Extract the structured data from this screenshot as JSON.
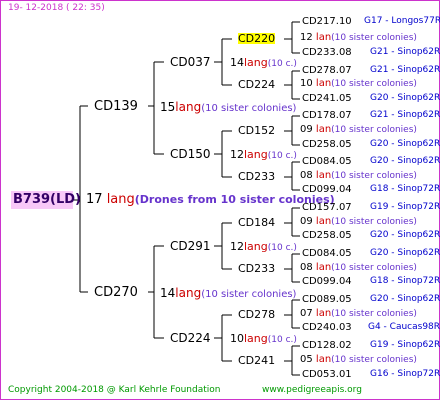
{
  "header": {
    "date": "19-  12-2018  ( 22: 35)"
  },
  "footer": {
    "copyright": "Copyright 2004-2018 @ Karl Kehrle Foundation",
    "website": "www.pedigreeapis.org"
  },
  "root": {
    "id": "B739(LD)",
    "count": "17",
    "word": "lang",
    "note": "(Drones from 10 sister colonies)"
  },
  "gen1": [
    {
      "id": "CD139",
      "count": "15",
      "word": "lang",
      "note": "(10 sister colonies)"
    },
    {
      "id": "CD270",
      "count": "14",
      "word": "lang",
      "note": "(10 sister colonies)"
    }
  ],
  "gen2": [
    {
      "id": "CD037",
      "count": "14",
      "word": "lang",
      "note": "(10 c.)"
    },
    {
      "id": "CD150",
      "count": "12",
      "word": "lang",
      "note": "(10 c.)"
    },
    {
      "id": "CD291",
      "count": "12",
      "word": "lang",
      "note": "(10 c.)"
    },
    {
      "id": "CD224",
      "count": "10",
      "word": "lang",
      "note": "(10 c.)"
    }
  ],
  "gen3": [
    {
      "id": "CD220",
      "count": "12",
      "word": "lan",
      "note": "(10 sister colonies)"
    },
    {
      "id": "CD224",
      "count": "10",
      "word": "lan",
      "note": "(10 sister colonies)"
    },
    {
      "id": "CD152",
      "count": "09",
      "word": "lan",
      "note": "(10 sister colonies)"
    },
    {
      "id": "CD233",
      "count": "08",
      "word": "lan",
      "note": "(10 sister colonies)"
    },
    {
      "id": "CD184",
      "count": "09",
      "word": "lan",
      "note": "(10 sister colonies)"
    },
    {
      "id": "CD233",
      "count": "08",
      "word": "lan",
      "note": "(10 sister colonies)"
    },
    {
      "id": "CD278",
      "count": "07",
      "word": "lan",
      "note": "(10 sister colonies)"
    },
    {
      "id": "CD241",
      "count": "05",
      "word": "lan",
      "note": "(10 sister colonies)"
    }
  ],
  "gen4": [
    {
      "id": "CD217.10",
      "origin": "G17 - Longos77R"
    },
    {
      "id": "CD233.08",
      "origin": "G21 - Sinop62R"
    },
    {
      "id": "CD278.07",
      "origin": "G21 - Sinop62R"
    },
    {
      "id": "CD241.05",
      "origin": "G20 - Sinop62R"
    },
    {
      "id": "CD178.07",
      "origin": "G21 - Sinop62R"
    },
    {
      "id": "CD258.05",
      "origin": "G20 - Sinop62R"
    },
    {
      "id": "CD084.05",
      "origin": "G20 - Sinop62R"
    },
    {
      "id": "CD099.04",
      "origin": "G18 - Sinop72R"
    },
    {
      "id": "CD157.07",
      "origin": "G19 - Sinop72R"
    },
    {
      "id": "CD258.05",
      "origin": "G20 - Sinop62R"
    },
    {
      "id": "CD084.05",
      "origin": "G20 - Sinop62R"
    },
    {
      "id": "CD099.04",
      "origin": "G18 - Sinop72R"
    },
    {
      "id": "CD089.05",
      "origin": "G20 - Sinop62R"
    },
    {
      "id": "CD240.03",
      "origin": "G4 - Caucas98R"
    },
    {
      "id": "CD128.02",
      "origin": "G19 - Sinop62R"
    },
    {
      "id": "CD053.01",
      "origin": "G16 - Sinop72R"
    }
  ],
  "colors": {
    "border": "#cc33cc",
    "count": "#000000",
    "lang": "#cc0000",
    "note": "#6633cc",
    "origin": "#0000cc",
    "footer": "#009900",
    "highlight": "#ffff00"
  }
}
